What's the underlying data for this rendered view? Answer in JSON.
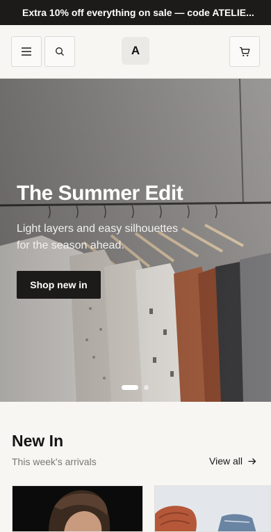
{
  "promo": {
    "text": "Extra 10% off everything on sale — code ATELIE..."
  },
  "header": {
    "logo": "A",
    "menu_icon": "menu-icon",
    "search_icon": "search-icon",
    "cart_icon": "cart-icon"
  },
  "hero": {
    "title": "The Summer Edit",
    "subtitle": "Light layers and easy silhouettes for the season ahead.",
    "cta": "Shop new in",
    "slides": 2,
    "active_slide": 1
  },
  "new_in": {
    "title": "New In",
    "subtitle": "This week's arrivals",
    "view_all": "View all",
    "view_all_icon": "arrow-right-icon"
  },
  "colors": {
    "dark": "#1c1b1a",
    "background": "#f7f6f3"
  }
}
